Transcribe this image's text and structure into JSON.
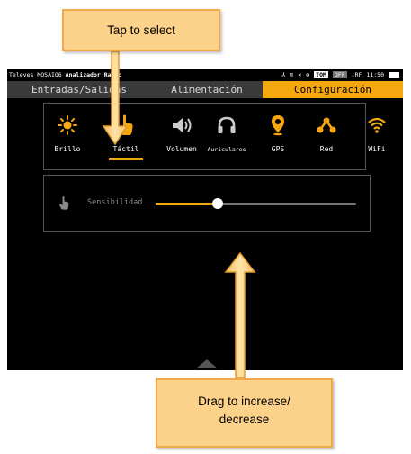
{
  "status_bar": {
    "brand": "Televes",
    "model": "MOSAIQ6",
    "app": "Analizador Radio",
    "icons": [
      "network-icon",
      "wifi-icon",
      "antenna-icon",
      "settings-icon"
    ],
    "tom_badge": "TOM",
    "off_badge": "OFF",
    "rf_label": "RF",
    "time": "11:50"
  },
  "tabs": [
    {
      "label": "Entradas/Salidas",
      "active": false
    },
    {
      "label": "Alimentación",
      "active": false
    },
    {
      "label": "Configuración",
      "active": true
    }
  ],
  "settings_icons": [
    {
      "icon": "brightness-icon",
      "label": "Brillo"
    },
    {
      "icon": "touch-hand-icon",
      "label": "Táctil",
      "selected": true
    },
    {
      "icon": "volume-icon",
      "label": "Volumen"
    },
    {
      "icon": "headphones-icon",
      "label": "Auriculares"
    },
    {
      "icon": "gps-pin-icon",
      "label": "GPS"
    },
    {
      "icon": "network-share-icon",
      "label": "Red"
    },
    {
      "icon": "wifi-icon",
      "label": "WiFi"
    }
  ],
  "sensitivity": {
    "label": "Sensibilidad",
    "value_fraction": 0.31
  },
  "callouts": {
    "tap": "Tap to select",
    "drag_line1": "Drag to increase/",
    "drag_line2": "decrease"
  },
  "colors": {
    "accent": "#f5a70f",
    "callout_fill": "#fcd28a",
    "callout_border": "#f0a94a"
  }
}
